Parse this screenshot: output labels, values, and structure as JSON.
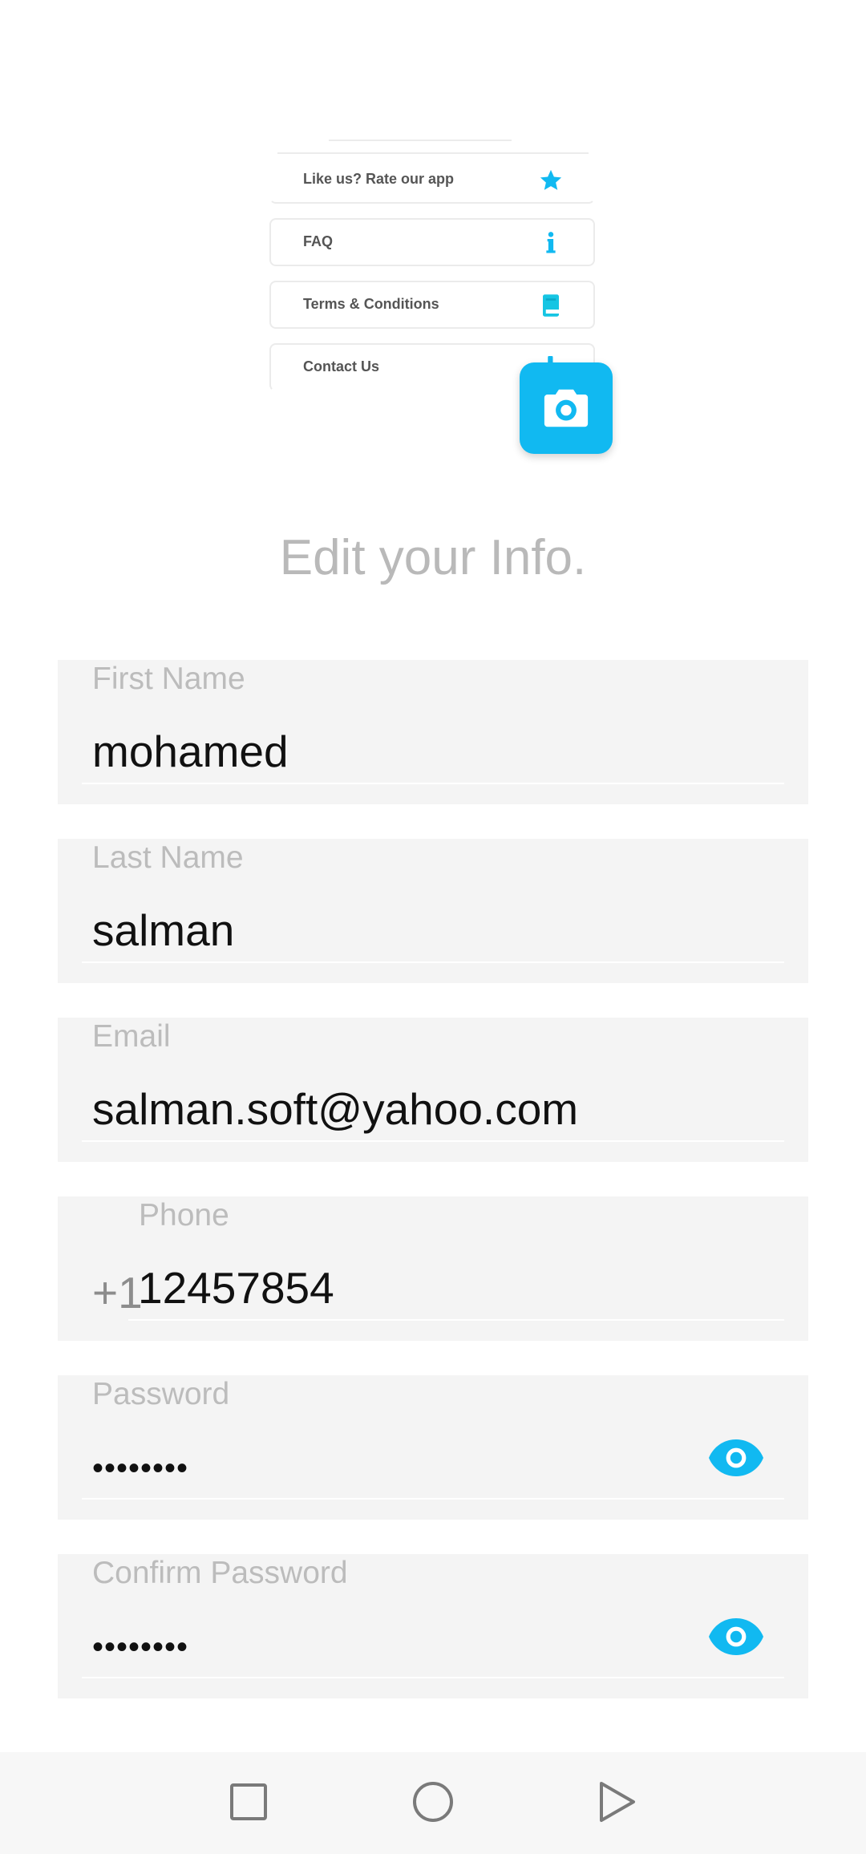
{
  "menu_preview": {
    "items": [
      {
        "label": "Like us? Rate our app",
        "icon": "star-icon"
      },
      {
        "label": "FAQ",
        "icon": "info-icon"
      },
      {
        "label": "Terms & Conditions",
        "icon": "book-icon"
      },
      {
        "label": "Contact Us",
        "icon": "phone-icon"
      }
    ]
  },
  "camera_button": {
    "icon": "camera-icon"
  },
  "title": "Edit your Info.",
  "form": {
    "first_name": {
      "label": "First Name",
      "value": "mohamed"
    },
    "last_name": {
      "label": "Last Name",
      "value": "salman"
    },
    "email": {
      "label": "Email",
      "value": "salman.soft@yahoo.com"
    },
    "phone": {
      "label": "Phone",
      "prefix": "+1",
      "value": "12457854"
    },
    "password": {
      "label": "Password",
      "value": "••••••••",
      "icon": "eye-icon"
    },
    "confirm_password": {
      "label": "Confirm Password",
      "value": "••••••••",
      "icon": "eye-icon"
    }
  },
  "navbar": {
    "icons": [
      "recents-icon",
      "home-icon",
      "back-icon"
    ]
  },
  "colors": {
    "accent": "#11b9f1",
    "label": "#bcbcbc",
    "field_bg": "#f4f4f4"
  }
}
